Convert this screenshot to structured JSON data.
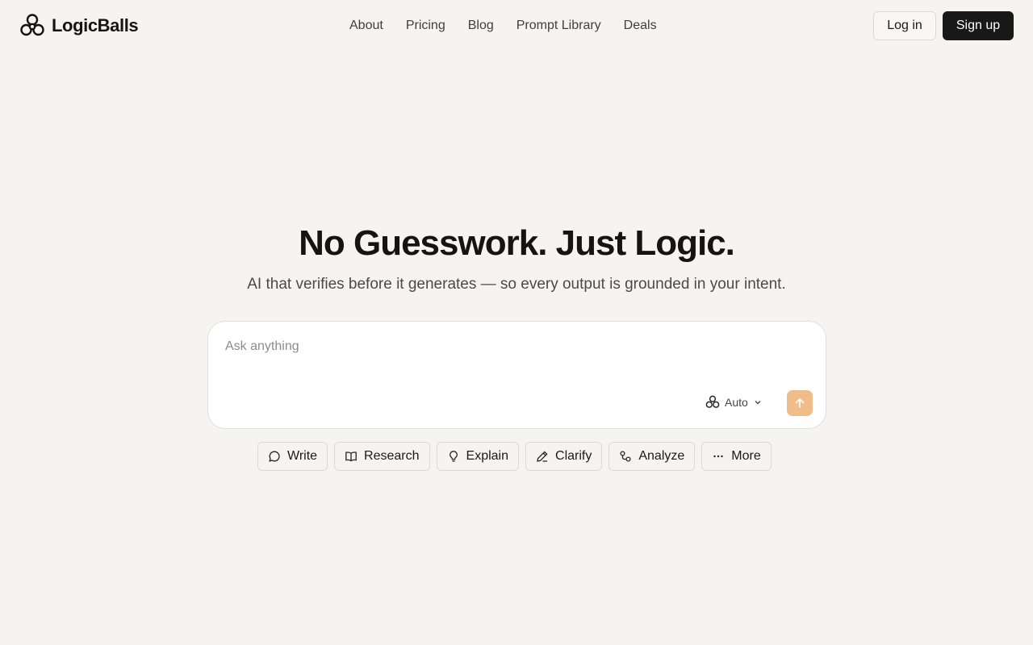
{
  "header": {
    "brand": "LogicBalls",
    "nav": [
      {
        "label": "About"
      },
      {
        "label": "Pricing"
      },
      {
        "label": "Blog"
      },
      {
        "label": "Prompt Library"
      },
      {
        "label": "Deals"
      }
    ],
    "login_label": "Log in",
    "signup_label": "Sign up",
    "logo_icon": "logicballs-logo-icon"
  },
  "hero": {
    "title": "No Guesswork. Just Logic.",
    "subtitle": "AI that verifies before it generates — so every output is grounded in your intent."
  },
  "prompt": {
    "placeholder": "Ask anything",
    "value": "",
    "model_label": "Auto",
    "model_icon": "logicballs-logo-icon",
    "send_icon": "arrow-up-icon",
    "send_color": "#efbd8a"
  },
  "chips": [
    {
      "label": "Write",
      "icon": "chat-bubble-icon"
    },
    {
      "label": "Research",
      "icon": "book-open-icon"
    },
    {
      "label": "Explain",
      "icon": "lightbulb-icon"
    },
    {
      "label": "Clarify",
      "icon": "pencil-icon"
    },
    {
      "label": "Analyze",
      "icon": "nodes-icon"
    },
    {
      "label": "More",
      "icon": "ellipsis-icon"
    }
  ],
  "colors": {
    "background": "#f5f4f0",
    "primary_button": "#181818",
    "accent": "#efbd8a"
  }
}
